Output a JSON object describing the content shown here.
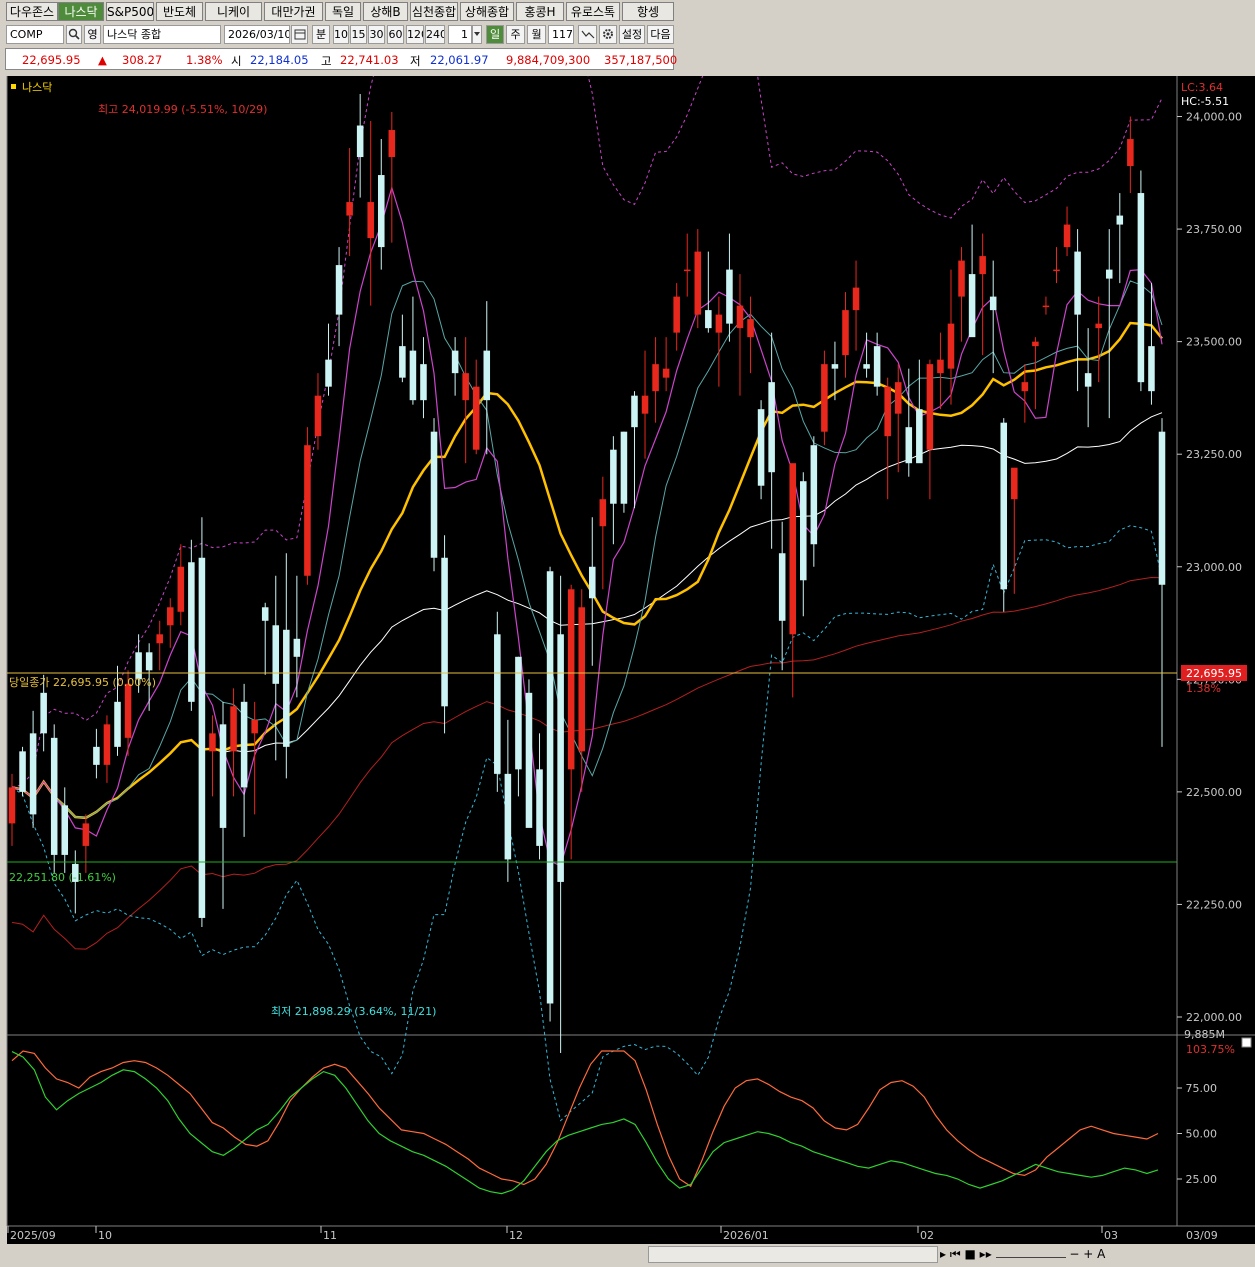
{
  "tabs": [
    "다우존스",
    "나스닥",
    "S&P500",
    "반도체",
    "니케이",
    "대만가권",
    "독일",
    "상해B",
    "심천종합",
    "상해종합",
    "홍콩H",
    "유로스톡",
    "항셍"
  ],
  "active_tab": 1,
  "toolbar": {
    "code": "COMP",
    "name_label": "영",
    "name": "나스닥 종합",
    "date": "2026/03/10",
    "period_label": "분",
    "periods": [
      "10",
      "15",
      "30",
      "60",
      "120",
      "240"
    ],
    "count": "1",
    "day": "일",
    "week": "주",
    "month": "월",
    "bars": "117",
    "settings": "설정",
    "next": "다음"
  },
  "quote": {
    "price": "22,695.95",
    "arrow": "▲",
    "change": "308.27",
    "pct": "1.38%",
    "open_label": "시",
    "open": "22,184.05",
    "high_label": "고",
    "high": "22,741.03",
    "low_label": "저",
    "low": "22,061.97",
    "volume": "9,884,709,300",
    "amount": "357,187,500"
  },
  "chart": {
    "title": "나스닥",
    "lc": "LC:3.64",
    "hc": "HC:-5.51",
    "current_tag": "22,695.95",
    "current_pct": "1.38%",
    "today_close": "당일종가 22,695.95 (0.00%)",
    "support_line": "22,251.80 (-1.61%)",
    "max_label": "최고 24,019.99 (-5.51%, 10/29)",
    "min_label": "최저 21,898.29 (3.64%, 11/21)",
    "vol_label": "9,885M",
    "osc_pct": "103.75%",
    "colors": {
      "up": "#e8281c",
      "down": "#cdf4f4",
      "ma5": "#cc44cc",
      "ma10": "#5aa6a6",
      "ma20": "#ffc000",
      "ma60": "#ffffff",
      "ma120": "#b42020"
    }
  },
  "chart_data": {
    "type": "candlestick",
    "ylim": [
      21960,
      24090
    ],
    "y_ticks": [
      "24,000.00",
      "23,750.00",
      "23,500.00",
      "23,250.00",
      "23,000.00",
      "22,750.00",
      "22,500.00",
      "22,250.00",
      "22,000.00"
    ],
    "y_tick_values": [
      24000,
      23750,
      23500,
      23250,
      23000,
      22750,
      22500,
      22250,
      22000
    ],
    "x_labels": [
      "2025/09",
      "10",
      "11",
      "12",
      "2026/01",
      "02",
      "03"
    ],
    "last_x_label": "03/09",
    "osc_ticks": [
      "75.00",
      "50.00",
      "25.00"
    ],
    "osc_tick_values": [
      75,
      50,
      25
    ],
    "ohlc": [
      [
        22430,
        22540,
        22380,
        22510
      ],
      [
        22590,
        22600,
        22490,
        22500
      ],
      [
        22630,
        22680,
        22420,
        22450
      ],
      [
        22720,
        22760,
        22590,
        22630
      ],
      [
        22620,
        22650,
        22320,
        22360
      ],
      [
        22470,
        22510,
        22320,
        22360
      ],
      [
        22340,
        22370,
        22230,
        22300
      ],
      [
        22380,
        22450,
        22320,
        22430
      ],
      [
        22600,
        22640,
        22530,
        22560
      ],
      [
        22560,
        22670,
        22520,
        22650
      ],
      [
        22700,
        22780,
        22580,
        22600
      ],
      [
        22620,
        22770,
        22580,
        22740
      ],
      [
        22810,
        22850,
        22720,
        22750
      ],
      [
        22810,
        22830,
        22680,
        22770
      ],
      [
        22830,
        22880,
        22770,
        22850
      ],
      [
        22870,
        22930,
        22820,
        22910
      ],
      [
        22900,
        23050,
        22870,
        23000
      ],
      [
        23010,
        23060,
        22680,
        22700
      ],
      [
        23020,
        23110,
        22200,
        22220
      ],
      [
        22590,
        22670,
        22490,
        22630
      ],
      [
        22650,
        22700,
        22240,
        22420
      ],
      [
        22590,
        22730,
        22490,
        22690
      ],
      [
        22700,
        22740,
        22400,
        22510
      ],
      [
        22630,
        22700,
        22450,
        22660
      ],
      [
        22910,
        22920,
        22760,
        22880
      ],
      [
        22870,
        22980,
        22570,
        22740
      ],
      [
        22860,
        23030,
        22530,
        22600
      ],
      [
        22840,
        22980,
        22710,
        22800
      ],
      [
        22980,
        23310,
        22960,
        23270
      ],
      [
        23290,
        23430,
        23260,
        23380
      ],
      [
        23460,
        23540,
        23380,
        23400
      ],
      [
        23670,
        23710,
        23490,
        23560
      ],
      [
        23780,
        23930,
        23690,
        23810
      ],
      [
        23980,
        24050,
        23820,
        23910
      ],
      [
        23730,
        23990,
        23580,
        23810
      ],
      [
        23870,
        23950,
        23660,
        23710
      ],
      [
        23910,
        24010,
        23720,
        23970
      ],
      [
        23490,
        23560,
        23410,
        23420
      ],
      [
        23480,
        23600,
        23360,
        23370
      ],
      [
        23450,
        23510,
        23330,
        23370
      ],
      [
        23300,
        23330,
        22990,
        23020
      ],
      [
        23020,
        23070,
        22630,
        22690
      ],
      [
        23480,
        23510,
        23380,
        23430
      ],
      [
        23370,
        23510,
        23230,
        23430
      ],
      [
        23260,
        23460,
        23250,
        23400
      ],
      [
        23480,
        23590,
        23250,
        23370
      ],
      [
        22850,
        22900,
        22500,
        22540
      ],
      [
        22540,
        22660,
        22300,
        22350
      ],
      [
        22800,
        22800,
        22490,
        22550
      ],
      [
        22720,
        22750,
        22450,
        22420
      ],
      [
        22550,
        22630,
        22350,
        22380
      ],
      [
        22990,
        23000,
        21990,
        22030
      ],
      [
        22850,
        22980,
        21920,
        22300
      ],
      [
        22550,
        22960,
        22350,
        22950
      ],
      [
        22590,
        22950,
        22500,
        22910
      ],
      [
        23000,
        23110,
        22780,
        22930
      ],
      [
        23090,
        23200,
        22950,
        23150
      ],
      [
        23260,
        23290,
        23050,
        23140
      ],
      [
        23300,
        23300,
        23120,
        23140
      ],
      [
        23380,
        23390,
        23130,
        23310
      ],
      [
        23340,
        23480,
        23240,
        23380
      ],
      [
        23390,
        23510,
        23320,
        23450
      ],
      [
        23420,
        23510,
        23390,
        23440
      ],
      [
        23520,
        23630,
        23480,
        23600
      ],
      [
        23660,
        23740,
        23600,
        23660
      ],
      [
        23560,
        23750,
        23530,
        23700
      ],
      [
        23570,
        23700,
        23520,
        23530
      ],
      [
        23520,
        23600,
        23400,
        23560
      ],
      [
        23660,
        23740,
        23500,
        23540
      ],
      [
        23530,
        23650,
        23380,
        23580
      ],
      [
        23510,
        23600,
        23430,
        23550
      ],
      [
        23350,
        23370,
        23150,
        23180
      ],
      [
        23410,
        23520,
        23040,
        23210
      ],
      [
        23030,
        23100,
        22770,
        22880
      ],
      [
        22850,
        23220,
        22710,
        23230
      ],
      [
        23190,
        23210,
        22890,
        22970
      ],
      [
        23270,
        23290,
        23000,
        23050
      ],
      [
        23300,
        23480,
        23270,
        23450
      ],
      [
        23450,
        23500,
        23370,
        23440
      ],
      [
        23470,
        23610,
        23420,
        23570
      ],
      [
        23570,
        23680,
        23480,
        23620
      ],
      [
        23450,
        23520,
        23420,
        23440
      ],
      [
        23490,
        23520,
        23380,
        23400
      ],
      [
        23290,
        23420,
        23150,
        23400
      ],
      [
        23340,
        23450,
        23210,
        23410
      ],
      [
        23310,
        23440,
        23200,
        23230
      ],
      [
        23350,
        23460,
        23310,
        23230
      ],
      [
        23260,
        23460,
        23150,
        23450
      ],
      [
        23430,
        23520,
        23350,
        23460
      ],
      [
        23440,
        23660,
        23360,
        23540
      ],
      [
        23600,
        23710,
        23500,
        23680
      ],
      [
        23650,
        23760,
        23550,
        23510
      ],
      [
        23650,
        23740,
        23470,
        23690
      ],
      [
        23600,
        23680,
        23430,
        23570
      ],
      [
        23320,
        23330,
        22900,
        22950
      ],
      [
        23150,
        23170,
        22940,
        23220
      ],
      [
        23390,
        23450,
        23320,
        23410
      ],
      [
        23490,
        23510,
        23350,
        23500
      ],
      [
        23580,
        23600,
        23560,
        23580
      ],
      [
        23660,
        23710,
        23630,
        23660
      ],
      [
        23710,
        23800,
        23690,
        23760
      ],
      [
        23700,
        23750,
        23390,
        23560
      ],
      [
        23430,
        23530,
        23310,
        23400
      ],
      [
        23530,
        23600,
        23410,
        23540
      ],
      [
        23660,
        23750,
        23330,
        23640
      ],
      [
        23780,
        23830,
        23630,
        23760
      ],
      [
        23890,
        24000,
        23830,
        23950
      ],
      [
        23830,
        23880,
        23390,
        23410
      ],
      [
        23490,
        23630,
        23360,
        23390
      ],
      [
        23300,
        23330,
        22600,
        22960
      ]
    ],
    "osc_a": [
      90,
      97,
      94,
      86,
      80,
      78,
      75,
      81,
      84,
      86,
      89,
      90,
      89,
      86,
      82,
      77,
      72,
      64,
      56,
      53,
      48,
      44,
      43,
      46,
      56,
      68,
      75,
      81,
      86,
      88,
      86,
      79,
      72,
      64,
      58,
      52,
      51,
      50,
      47,
      44,
      40,
      36,
      31,
      28,
      25,
      24,
      22,
      25,
      33,
      45,
      60,
      75,
      88,
      98,
      103,
      101,
      90,
      74,
      55,
      38,
      25,
      21,
      35,
      51,
      65,
      75,
      79,
      80,
      77,
      73,
      70,
      68,
      64,
      57,
      53,
      52,
      55,
      64,
      74,
      78,
      79,
      76,
      70,
      60,
      52,
      46,
      41,
      37,
      34,
      31,
      28,
      27,
      30,
      37,
      42,
      47,
      52,
      54,
      52,
      50,
      49,
      48,
      47,
      50
    ],
    "osc_b": [
      95,
      92,
      85,
      70,
      63,
      68,
      72,
      75,
      78,
      82,
      85,
      84,
      80,
      75,
      68,
      58,
      50,
      45,
      40,
      38,
      42,
      47,
      52,
      55,
      62,
      70,
      75,
      80,
      84,
      82,
      75,
      66,
      57,
      50,
      46,
      43,
      40,
      38,
      35,
      32,
      28,
      24,
      20,
      18,
      17,
      19,
      24,
      32,
      40,
      46,
      49,
      51,
      53,
      55,
      56,
      58,
      55,
      45,
      34,
      25,
      20,
      22,
      31,
      40,
      45,
      47,
      49,
      51,
      50,
      48,
      45,
      43,
      40,
      38,
      36,
      34,
      32,
      31,
      33,
      35,
      34,
      32,
      30,
      28,
      27,
      25,
      22,
      20,
      22,
      24,
      27,
      30,
      33,
      31,
      29,
      28,
      27,
      26,
      27,
      29,
      31,
      30,
      28,
      30
    ]
  }
}
